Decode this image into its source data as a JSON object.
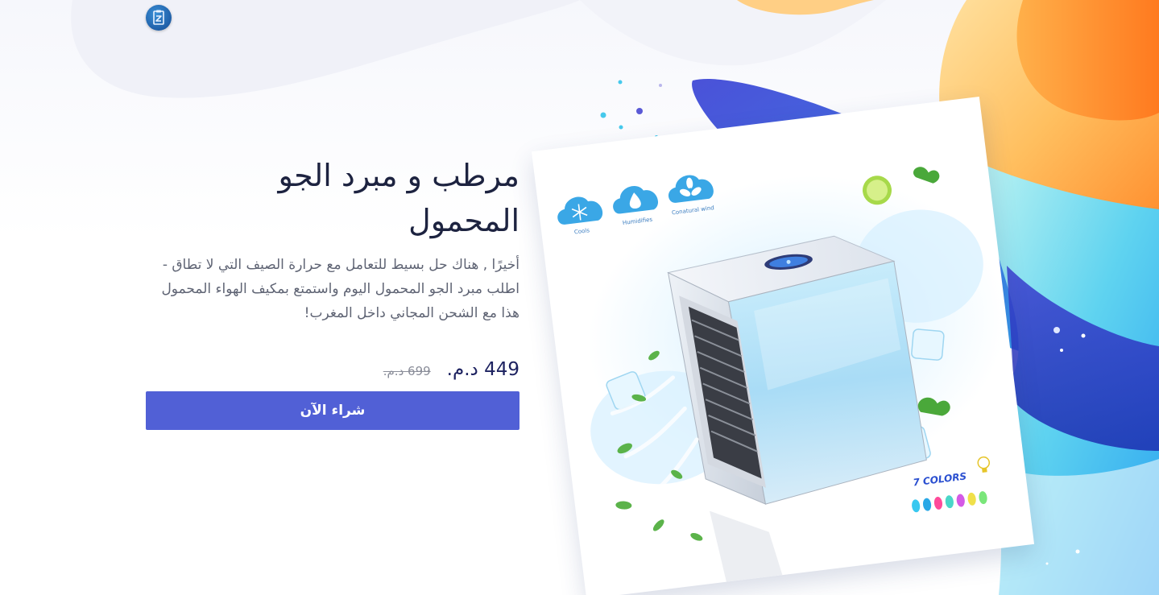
{
  "header": {
    "logo_icon": "z-box-logo-icon"
  },
  "hero": {
    "title": "مرطب و مبرد الجو المحمول",
    "description": "أخيرًا , هناك حل بسيط للتعامل مع حرارة الصيف التي لا تطاق - اطلب مبرد الجو المحمول اليوم واستمتع بمكيف الهواء المحمول هذا مع الشحن المجاني داخل المغرب!",
    "price_new": "449 د.م.",
    "price_old": "699 د.م.",
    "buy_label": "شراء الآن"
  },
  "product_image": {
    "features": [
      {
        "label": "Cools",
        "icon": "snowflake-icon"
      },
      {
        "label": "Humidifies",
        "icon": "water-drop-icon"
      },
      {
        "label": "Conatural wind",
        "icon": "fan-icon"
      }
    ],
    "colors_label": "7 COLORS"
  },
  "colors": {
    "accent": "#5160d6",
    "title": "#1d2340",
    "text": "#5f6474"
  }
}
